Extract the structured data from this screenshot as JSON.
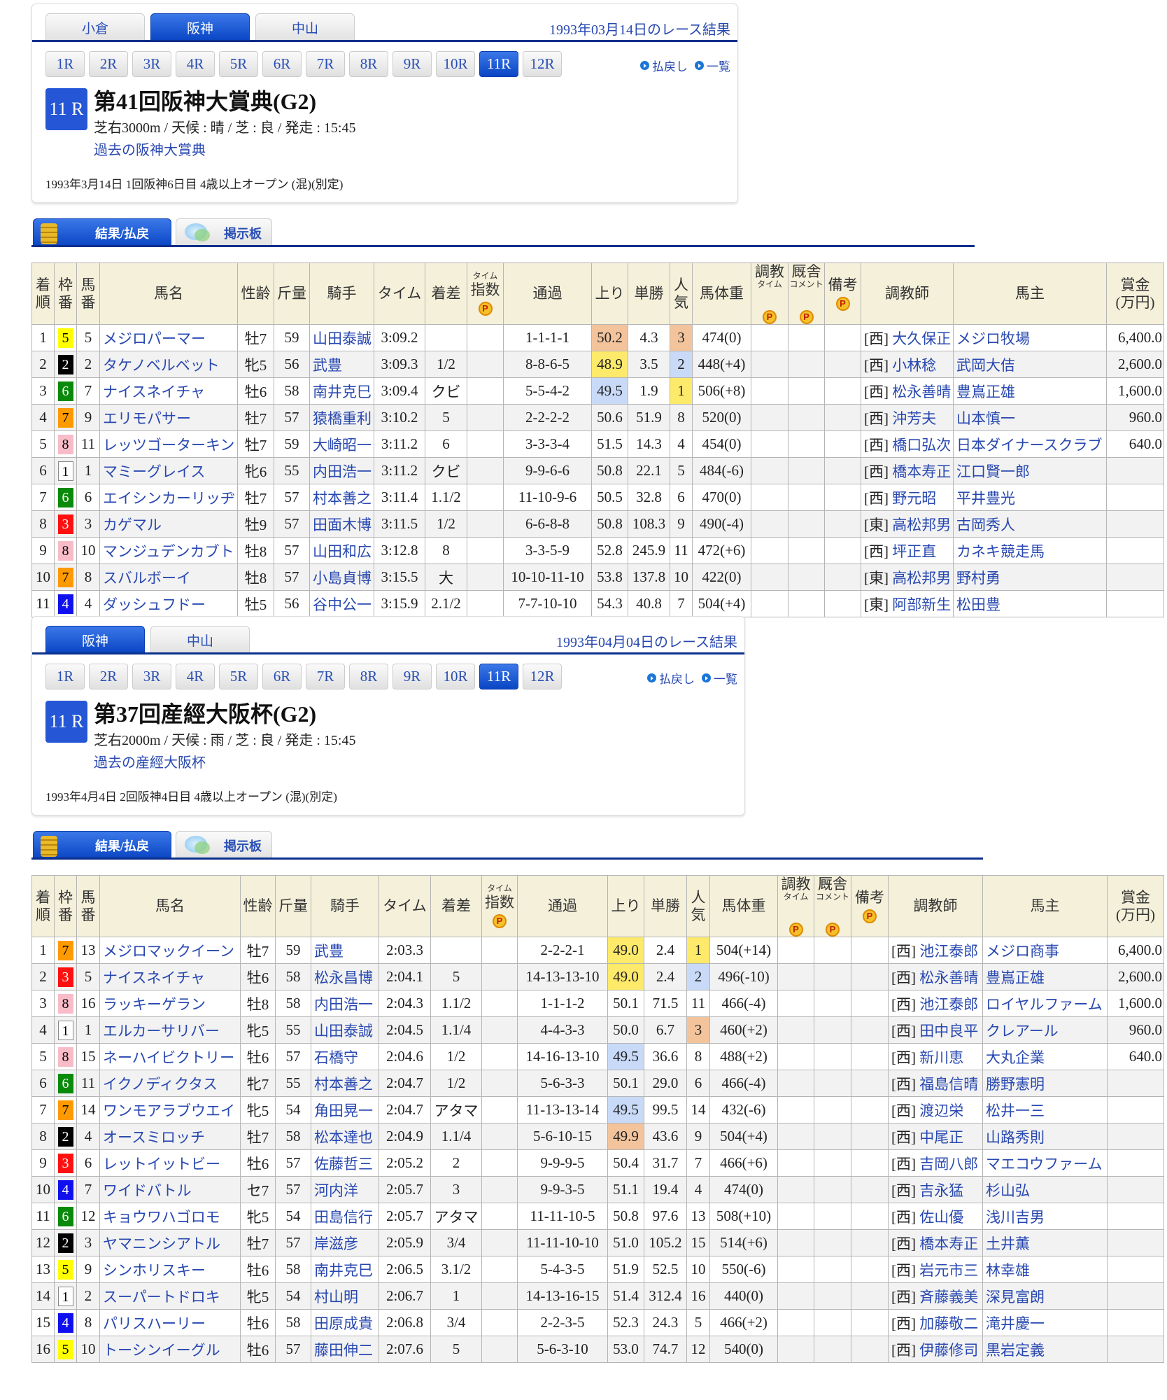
{
  "frame_colors": {
    "1": "#ffffff",
    "2": "#000000",
    "3": "#ff1010",
    "4": "#1010ee",
    "5": "#ffff00",
    "6": "#0a8a0a",
    "7": "#ff9a00",
    "8": "#f8bcc8"
  },
  "highlight_colors": {
    "first": "#fde96a",
    "second": "#c8daf8",
    "third": "#f3c49c"
  },
  "race_buttons": [
    "1R",
    "2R",
    "3R",
    "4R",
    "5R",
    "6R",
    "7R",
    "8R",
    "9R",
    "10R",
    "11R",
    "12R"
  ],
  "links": {
    "payout": "払戻し",
    "list": "一覧"
  },
  "result_tabs": {
    "results": "結果/払戻",
    "board": "掲示板"
  },
  "headers": [
    {
      "main": "着順"
    },
    {
      "main": "枠番"
    },
    {
      "main": "馬番"
    },
    {
      "main": "馬名"
    },
    {
      "main": "性齢"
    },
    {
      "main": "斤量"
    },
    {
      "main": "騎手"
    },
    {
      "main": "タイム"
    },
    {
      "main": "着差"
    },
    {
      "top": "タイム",
      "main": "指数",
      "p": "P"
    },
    {
      "main": "通過"
    },
    {
      "main": "上り"
    },
    {
      "main": "単勝"
    },
    {
      "main": "人気"
    },
    {
      "main": "馬体重"
    },
    {
      "main": "調教",
      "sub": "タイム",
      "p": "P"
    },
    {
      "main": "厩舎",
      "sub": "コメント",
      "p": "P"
    },
    {
      "main": "備考",
      "p": "P"
    },
    {
      "main": "調教師"
    },
    {
      "main": "馬主"
    },
    {
      "main": "賞金",
      "line2": "(万円)"
    }
  ],
  "races": [
    {
      "venues": [
        "小倉",
        "阪神",
        "中山"
      ],
      "active_venue": 1,
      "active_race": 10,
      "date_heading": "1993年03月14日のレース結果",
      "badge": "11 R",
      "title": "第41回阪神大賞典(G2)",
      "details": "芝右3000m / 天候 : 晴 / 芝 : 良 / 発走 : 15:45",
      "past_link": "過去の阪神大賞典",
      "info": "1993年3月14日 1回阪神6日目 4歳以上オープン  (混)(別定)",
      "rows": [
        [
          "1",
          "5",
          "5",
          "メジロパーマー",
          "牡7",
          "59",
          "山田泰誠",
          "3:09.2",
          "",
          "1-1-1-1",
          "50.2",
          "4.3",
          "3",
          "474(0)",
          "[西]",
          "大久保正",
          "メジロ牧場",
          "6,400.0"
        ],
        [
          "2",
          "2",
          "2",
          "タケノベルベット",
          "牝5",
          "56",
          "武豊",
          "3:09.3",
          "1/2",
          "8-8-6-5",
          "48.9",
          "3.5",
          "2",
          "448(+4)",
          "[西]",
          "小林稔",
          "武岡大佶",
          "2,600.0"
        ],
        [
          "3",
          "6",
          "7",
          "ナイスネイチャ",
          "牡6",
          "58",
          "南井克巳",
          "3:09.4",
          "クビ",
          "5-5-4-2",
          "49.5",
          "1.9",
          "1",
          "506(+8)",
          "[西]",
          "松永善晴",
          "豊嶌正雄",
          "1,600.0"
        ],
        [
          "4",
          "7",
          "9",
          "エリモパサー",
          "牡7",
          "57",
          "猿橋重利",
          "3:10.2",
          "5",
          "2-2-2-2",
          "50.6",
          "51.9",
          "8",
          "520(0)",
          "[西]",
          "沖芳夫",
          "山本慎一",
          "960.0"
        ],
        [
          "5",
          "8",
          "11",
          "レッツゴーターキン",
          "牡7",
          "59",
          "大崎昭一",
          "3:11.2",
          "6",
          "3-3-3-4",
          "51.5",
          "14.3",
          "4",
          "454(0)",
          "[西]",
          "橋口弘次",
          "日本ダイナースクラブ",
          "640.0"
        ],
        [
          "6",
          "1",
          "1",
          "マミーグレイス",
          "牝6",
          "55",
          "内田浩一",
          "3:11.2",
          "クビ",
          "9-9-6-6",
          "50.8",
          "22.1",
          "5",
          "484(-6)",
          "[西]",
          "橋本寿正",
          "江口賢一郎",
          ""
        ],
        [
          "7",
          "6",
          "6",
          "エイシンカーリッヂ",
          "牡7",
          "57",
          "村本善之",
          "3:11.4",
          "1.1/2",
          "11-10-9-6",
          "50.5",
          "32.8",
          "6",
          "470(0)",
          "[西]",
          "野元昭",
          "平井豊光",
          ""
        ],
        [
          "8",
          "3",
          "3",
          "カゲマル",
          "牡9",
          "57",
          "田面木博",
          "3:11.5",
          "1/2",
          "6-6-8-8",
          "50.8",
          "108.3",
          "9",
          "490(-4)",
          "[東]",
          "高松邦男",
          "古岡秀人",
          ""
        ],
        [
          "9",
          "8",
          "10",
          "マンジュデンカブト",
          "牡8",
          "57",
          "山田和広",
          "3:12.8",
          "8",
          "3-3-5-9",
          "52.8",
          "245.9",
          "11",
          "472(+6)",
          "[西]",
          "坪正直",
          "カネキ競走馬",
          ""
        ],
        [
          "10",
          "7",
          "8",
          "スバルボーイ",
          "牡8",
          "57",
          "小島貞博",
          "3:15.5",
          "大",
          "10-10-11-10",
          "53.8",
          "137.8",
          "10",
          "422(0)",
          "[東]",
          "高松邦男",
          "野村勇",
          ""
        ],
        [
          "11",
          "4",
          "4",
          "ダッシュフドー",
          "牡5",
          "56",
          "谷中公一",
          "3:15.9",
          "2.1/2",
          "7-7-10-10",
          "54.3",
          "40.8",
          "7",
          "504(+4)",
          "[東]",
          "阿部新生",
          "松田豊",
          ""
        ]
      ]
    },
    {
      "venues": [
        "阪神",
        "中山"
      ],
      "active_venue": 0,
      "active_race": 10,
      "date_heading": "1993年04月04日のレース結果",
      "badge": "11 R",
      "title": "第37回産經大阪杯(G2)",
      "details": "芝右2000m / 天候 : 雨 / 芝 : 良 / 発走 : 15:45",
      "past_link": "過去の産經大阪杯",
      "info": "1993年4月4日 2回阪神4日目 4歳以上オープン  (混)(別定)",
      "rows": [
        [
          "1",
          "7",
          "13",
          "メジロマックイーン",
          "牡7",
          "59",
          "武豊",
          "2:03.3",
          "",
          "2-2-2-1",
          "49.0",
          "2.4",
          "1",
          "504(+14)",
          "[西]",
          "池江泰郎",
          "メジロ商事",
          "6,400.0"
        ],
        [
          "2",
          "3",
          "5",
          "ナイスネイチャ",
          "牡6",
          "58",
          "松永昌博",
          "2:04.1",
          "5",
          "14-13-13-10",
          "49.0",
          "2.4",
          "2",
          "496(-10)",
          "[西]",
          "松永善晴",
          "豊嶌正雄",
          "2,600.0"
        ],
        [
          "3",
          "8",
          "16",
          "ラッキーゲラン",
          "牡8",
          "58",
          "内田浩一",
          "2:04.3",
          "1.1/2",
          "1-1-1-2",
          "50.1",
          "71.5",
          "11",
          "466(-4)",
          "[西]",
          "池江泰郎",
          "ロイヤルファーム",
          "1,600.0"
        ],
        [
          "4",
          "1",
          "1",
          "エルカーサリバー",
          "牝5",
          "55",
          "山田泰誠",
          "2:04.5",
          "1.1/4",
          "4-4-3-3",
          "50.0",
          "6.7",
          "3",
          "460(+2)",
          "[西]",
          "田中良平",
          "クレアール",
          "960.0"
        ],
        [
          "5",
          "8",
          "15",
          "ネーハイビクトリー",
          "牡6",
          "57",
          "石橋守",
          "2:04.6",
          "1/2",
          "14-16-13-10",
          "49.5",
          "36.6",
          "8",
          "488(+2)",
          "[西]",
          "新川恵",
          "大丸企業",
          "640.0"
        ],
        [
          "6",
          "6",
          "11",
          "イクノディクタス",
          "牝7",
          "55",
          "村本善之",
          "2:04.7",
          "1/2",
          "5-6-3-3",
          "50.1",
          "29.0",
          "6",
          "466(-4)",
          "[西]",
          "福島信晴",
          "勝野憲明",
          ""
        ],
        [
          "7",
          "7",
          "14",
          "ワンモアラブウエイ",
          "牝5",
          "54",
          "角田晃一",
          "2:04.7",
          "アタマ",
          "11-13-13-14",
          "49.5",
          "99.5",
          "14",
          "432(-6)",
          "[西]",
          "渡辺栄",
          "松井一三",
          ""
        ],
        [
          "8",
          "2",
          "4",
          "オースミロッチ",
          "牡7",
          "58",
          "松本達也",
          "2:04.9",
          "1.1/4",
          "5-6-10-15",
          "49.9",
          "43.6",
          "9",
          "504(+4)",
          "[西]",
          "中尾正",
          "山路秀則",
          ""
        ],
        [
          "9",
          "3",
          "6",
          "レットイットビー",
          "牡6",
          "57",
          "佐藤哲三",
          "2:05.2",
          "2",
          "9-9-9-5",
          "50.4",
          "31.7",
          "7",
          "466(+6)",
          "[西]",
          "吉岡八郎",
          "マエコウファーム",
          ""
        ],
        [
          "10",
          "4",
          "7",
          "ワイドバトル",
          "セ7",
          "57",
          "河内洋",
          "2:05.7",
          "3",
          "9-9-3-5",
          "51.1",
          "19.4",
          "4",
          "474(0)",
          "[西]",
          "吉永猛",
          "杉山弘",
          ""
        ],
        [
          "11",
          "6",
          "12",
          "キョウワハゴロモ",
          "牝5",
          "54",
          "田島信行",
          "2:05.7",
          "アタマ",
          "11-11-10-5",
          "50.8",
          "97.6",
          "13",
          "508(+10)",
          "[西]",
          "佐山優",
          "浅川吉男",
          ""
        ],
        [
          "12",
          "2",
          "3",
          "ヤマニンシアトル",
          "牡7",
          "57",
          "岸滋彦",
          "2:05.9",
          "3/4",
          "11-11-10-10",
          "51.0",
          "105.2",
          "15",
          "514(+6)",
          "[西]",
          "橋本寿正",
          "土井薫",
          ""
        ],
        [
          "13",
          "5",
          "9",
          "シンホリスキー",
          "牡6",
          "58",
          "南井克巳",
          "2:06.5",
          "3.1/2",
          "5-4-3-5",
          "51.9",
          "52.5",
          "10",
          "550(-6)",
          "[西]",
          "岩元市三",
          "林幸雄",
          ""
        ],
        [
          "14",
          "1",
          "2",
          "スーパートドロキ",
          "牝5",
          "54",
          "村山明",
          "2:06.7",
          "1",
          "14-13-16-15",
          "51.4",
          "312.4",
          "16",
          "440(0)",
          "[西]",
          "斉藤義美",
          "深見富朗",
          ""
        ],
        [
          "15",
          "4",
          "8",
          "パリスハーリー",
          "牡6",
          "58",
          "田原成貴",
          "2:06.8",
          "3/4",
          "2-2-3-5",
          "52.3",
          "24.3",
          "5",
          "466(+2)",
          "[西]",
          "加藤敬二",
          "滝井慶一",
          ""
        ],
        [
          "16",
          "5",
          "10",
          "トーシンイーグル",
          "牡6",
          "57",
          "藤田伸二",
          "2:07.6",
          "5",
          "5-6-3-10",
          "53.0",
          "74.7",
          "12",
          "540(0)",
          "[西]",
          "伊藤修司",
          "黒岩定義",
          ""
        ]
      ]
    }
  ]
}
